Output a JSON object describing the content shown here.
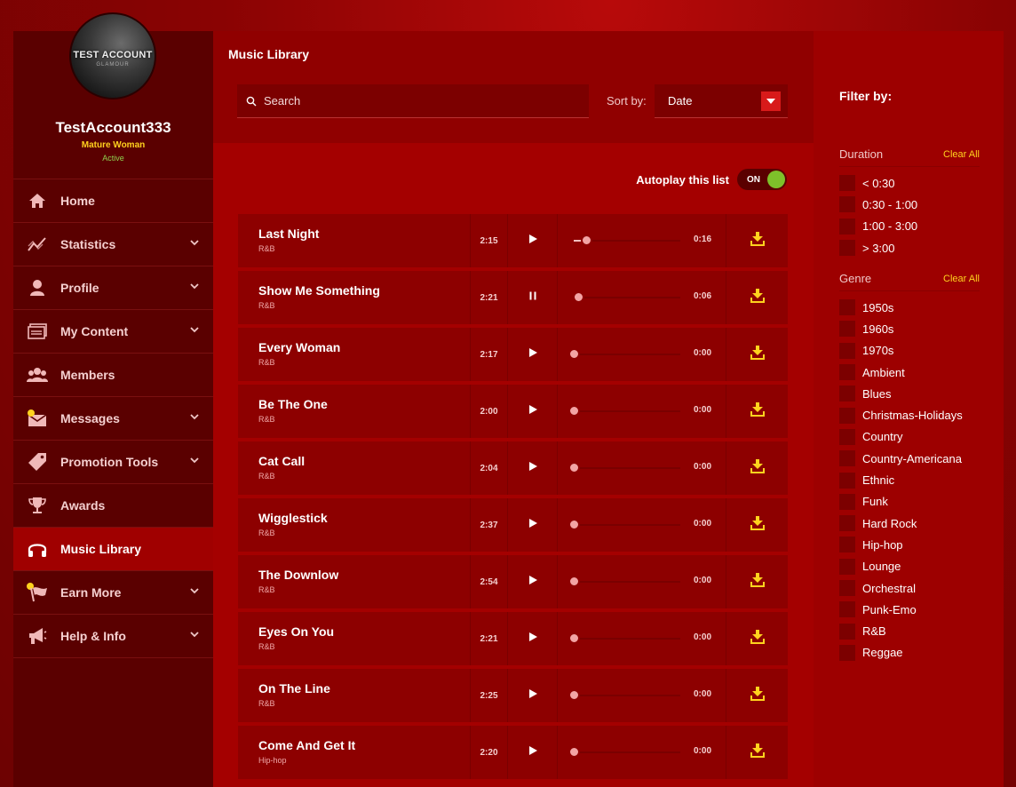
{
  "profile": {
    "avatar_text": "TEST ACCOUNT",
    "avatar_subtext": "GLAMOUR",
    "username": "TestAccount333",
    "role": "Mature Woman",
    "status": "Active"
  },
  "sidebar": {
    "items": [
      {
        "label": "Home",
        "icon": "home-icon",
        "chevron": false,
        "active": false
      },
      {
        "label": "Statistics",
        "icon": "chart-line-icon",
        "chevron": true,
        "active": false
      },
      {
        "label": "Profile",
        "icon": "user-icon",
        "chevron": true,
        "active": false
      },
      {
        "label": "My Content",
        "icon": "content-icon",
        "chevron": true,
        "active": false
      },
      {
        "label": "Members",
        "icon": "members-icon",
        "chevron": false,
        "active": false
      },
      {
        "label": "Messages",
        "icon": "envelope-icon",
        "chevron": true,
        "active": false
      },
      {
        "label": "Promotion Tools",
        "icon": "tag-icon",
        "chevron": true,
        "active": false
      },
      {
        "label": "Awards",
        "icon": "trophy-icon",
        "chevron": false,
        "active": false
      },
      {
        "label": "Music Library",
        "icon": "headphones-icon",
        "chevron": false,
        "active": true
      },
      {
        "label": "Earn More",
        "icon": "flag-icon",
        "chevron": true,
        "active": false
      },
      {
        "label": "Help & Info",
        "icon": "megaphone-icon",
        "chevron": true,
        "active": false
      }
    ]
  },
  "main": {
    "title": "Music Library",
    "search_placeholder": "Search",
    "sort_label": "Sort by:",
    "sort_value": "Date",
    "autoplay_label": "Autoplay this list",
    "autoplay_state": "ON"
  },
  "tracks": [
    {
      "title": "Last Night",
      "genre": "R&B",
      "duration": "2:15",
      "state": "play",
      "elapsed": "0:16",
      "progress": 0.12
    },
    {
      "title": "Show Me Something",
      "genre": "R&B",
      "duration": "2:21",
      "state": "pause",
      "elapsed": "0:06",
      "progress": 0.04
    },
    {
      "title": "Every Woman",
      "genre": "R&B",
      "duration": "2:17",
      "state": "play",
      "elapsed": "0:00",
      "progress": 0
    },
    {
      "title": "Be The One",
      "genre": "R&B",
      "duration": "2:00",
      "state": "play",
      "elapsed": "0:00",
      "progress": 0
    },
    {
      "title": "Cat Call",
      "genre": "R&B",
      "duration": "2:04",
      "state": "play",
      "elapsed": "0:00",
      "progress": 0
    },
    {
      "title": "Wigglestick",
      "genre": "R&B",
      "duration": "2:37",
      "state": "play",
      "elapsed": "0:00",
      "progress": 0
    },
    {
      "title": "The Downlow",
      "genre": "R&B",
      "duration": "2:54",
      "state": "play",
      "elapsed": "0:00",
      "progress": 0
    },
    {
      "title": "Eyes On You",
      "genre": "R&B",
      "duration": "2:21",
      "state": "play",
      "elapsed": "0:00",
      "progress": 0
    },
    {
      "title": "On The Line",
      "genre": "R&B",
      "duration": "2:25",
      "state": "play",
      "elapsed": "0:00",
      "progress": 0
    },
    {
      "title": "Come And Get It",
      "genre": "Hip-hop",
      "duration": "2:20",
      "state": "play",
      "elapsed": "0:00",
      "progress": 0
    }
  ],
  "filter": {
    "title": "Filter by:",
    "duration": {
      "label": "Duration",
      "clear": "Clear All",
      "options": [
        "< 0:30",
        "0:30 - 1:00",
        "1:00 - 3:00",
        "> 3:00"
      ]
    },
    "genre": {
      "label": "Genre",
      "clear": "Clear All",
      "options": [
        "1950s",
        "1960s",
        "1970s",
        "Ambient",
        "Blues",
        "Christmas-Holidays",
        "Country",
        "Country-Americana",
        "Ethnic",
        "Funk",
        "Hard Rock",
        "Hip-hop",
        "Lounge",
        "Orchestral",
        "Punk-Emo",
        "R&B",
        "Reggae"
      ]
    }
  },
  "colors": {
    "accent_yellow": "#ffd21e",
    "toggle_on": "#7ec12a",
    "sidebar_bg": "#5a0000",
    "main_bg": "#a40000"
  }
}
